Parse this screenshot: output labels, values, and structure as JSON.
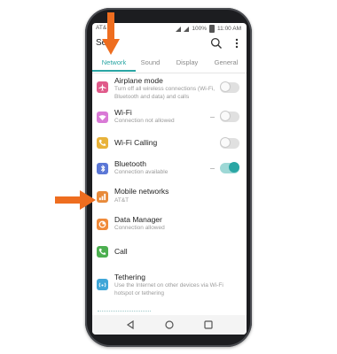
{
  "status_bar": {
    "carrier": "AT&",
    "battery": "100%",
    "time": "11:00 AM"
  },
  "header": {
    "title": "Se    s"
  },
  "tabs": [
    {
      "label": "Network",
      "active": true
    },
    {
      "label": "Sound",
      "active": false
    },
    {
      "label": "Display",
      "active": false
    },
    {
      "label": "General",
      "active": false
    }
  ],
  "settings": [
    {
      "icon": "airplane-icon",
      "color": "#e05a8a",
      "title": "Airplane mode",
      "subtitle": "Turn off all wireless connections (Wi-Fi, Bluetooth and data) and calls",
      "toggle": "off"
    },
    {
      "icon": "wifi-icon",
      "color": "#d97ad6",
      "title": "Wi-Fi",
      "subtitle": "Connection not allowed",
      "toggle": "off"
    },
    {
      "icon": "wifi-calling-icon",
      "color": "#e8b23a",
      "title": "Wi-Fi Calling",
      "subtitle": "",
      "toggle": "off"
    },
    {
      "icon": "bluetooth-icon",
      "color": "#5b77d6",
      "title": "Bluetooth",
      "subtitle": "Connection available",
      "toggle": "on"
    },
    {
      "icon": "mobile-networks-icon",
      "color": "#e88a3a",
      "title": "Mobile networks",
      "subtitle": "AT&T",
      "toggle": "none"
    },
    {
      "icon": "data-manager-icon",
      "color": "#f08a3a",
      "title": "Data Manager",
      "subtitle": "Connection allowed",
      "toggle": "none"
    },
    {
      "icon": "call-icon",
      "color": "#4caf50",
      "title": "Call",
      "subtitle": "",
      "toggle": "none"
    },
    {
      "icon": "tethering-icon",
      "color": "#3fa6d8",
      "title": "Tethering",
      "subtitle": "Use the Internet on other devices via Wi-Fi hotspot or tethering",
      "toggle": "none"
    }
  ],
  "colors": {
    "accent": "#2aa6a4",
    "callout_arrow": "#ee6d1f"
  }
}
